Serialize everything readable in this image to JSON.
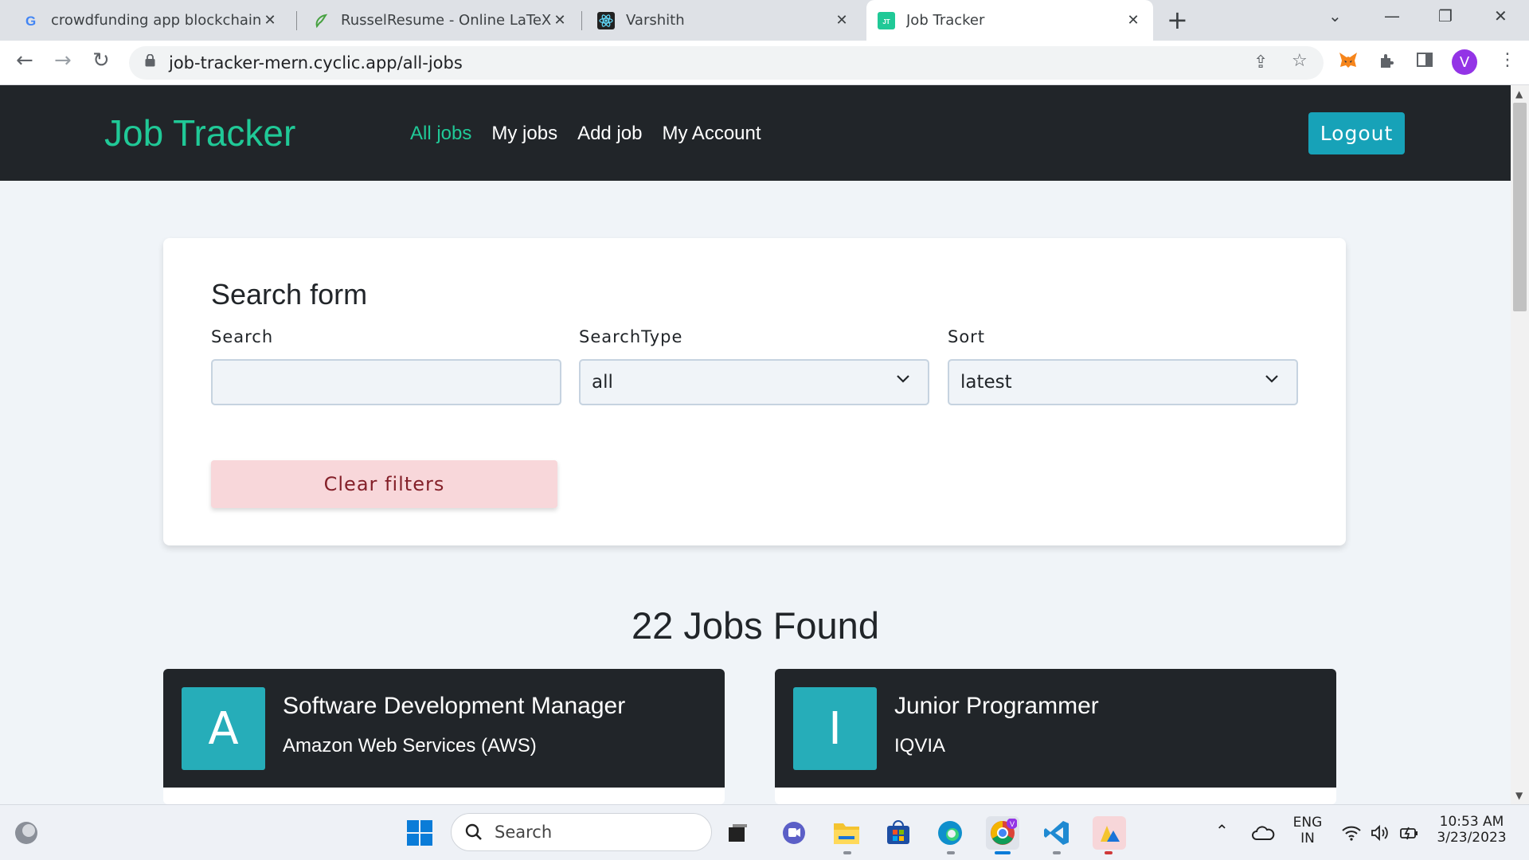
{
  "browser": {
    "tabs": [
      {
        "title": "crowdfunding app blockchain de",
        "icon": "google-icon"
      },
      {
        "title": "RusselResume - Online LaTeX Edi",
        "icon": "overleaf-icon"
      },
      {
        "title": "Varshith",
        "icon": "react-icon"
      },
      {
        "title": "Job Tracker",
        "icon": "jt-icon",
        "favicon_text": "JT",
        "active": true
      }
    ],
    "url": "job-tracker-mern.cyclic.app/all-jobs",
    "profile_initial": "V"
  },
  "app": {
    "brand": "Job Tracker",
    "nav": [
      {
        "label": "All jobs",
        "active": true
      },
      {
        "label": "My jobs"
      },
      {
        "label": "Add job"
      },
      {
        "label": "My Account"
      }
    ],
    "logout_label": "Logout",
    "accent_color": "#20c997"
  },
  "search_form": {
    "title": "Search form",
    "search_label": "Search",
    "search_value": "",
    "search_type_label": "SearchType",
    "search_type_value": "all",
    "sort_label": "Sort",
    "sort_value": "latest",
    "clear_label": "Clear filters"
  },
  "results": {
    "count_text": "22 Jobs Found",
    "jobs": [
      {
        "letter": "A",
        "title": "Software Development Manager",
        "company": "Amazon Web Services (AWS)"
      },
      {
        "letter": "I",
        "title": "Junior Programmer",
        "company": "IQVIA"
      }
    ]
  },
  "taskbar": {
    "search_label": "Search",
    "lang_top": "ENG",
    "lang_bottom": "IN",
    "time": "10:53 AM",
    "date": "3/23/2023"
  }
}
